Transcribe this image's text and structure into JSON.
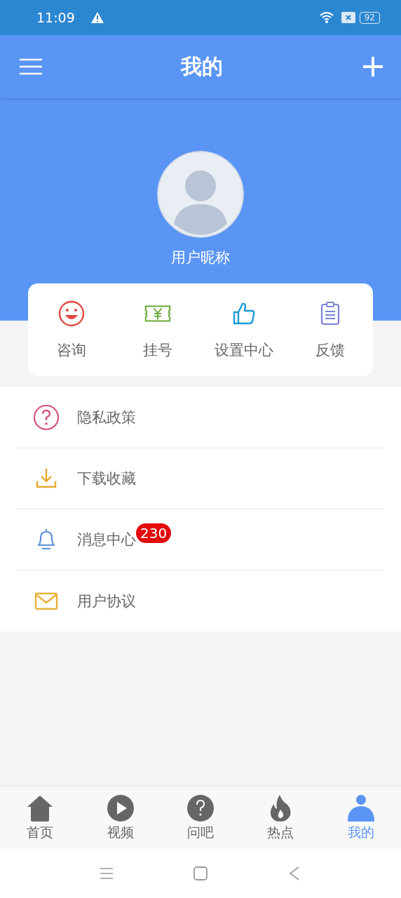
{
  "status_bar": {
    "time": "11:09",
    "battery": "92"
  },
  "header": {
    "title": "我的"
  },
  "profile": {
    "nickname": "用户昵称"
  },
  "quick_actions": [
    {
      "kind": "smile",
      "label": "咨询"
    },
    {
      "kind": "ticket",
      "label": "挂号"
    },
    {
      "kind": "thumb",
      "label": "设置中心"
    },
    {
      "kind": "clipboard",
      "label": "反馈"
    }
  ],
  "menu": [
    {
      "kind": "question",
      "label": "隐私政策"
    },
    {
      "kind": "download",
      "label": "下载收藏"
    },
    {
      "kind": "bell",
      "label": "消息中心",
      "badge": "230"
    },
    {
      "kind": "mail",
      "label": "用户协议"
    }
  ],
  "tab_bar": [
    {
      "kind": "home",
      "label": "首页",
      "selected": false
    },
    {
      "kind": "video",
      "label": "视频",
      "selected": false
    },
    {
      "kind": "ask",
      "label": "问吧",
      "selected": false
    },
    {
      "kind": "hot",
      "label": "热点",
      "selected": false
    },
    {
      "kind": "me",
      "label": "我的",
      "selected": true
    }
  ]
}
